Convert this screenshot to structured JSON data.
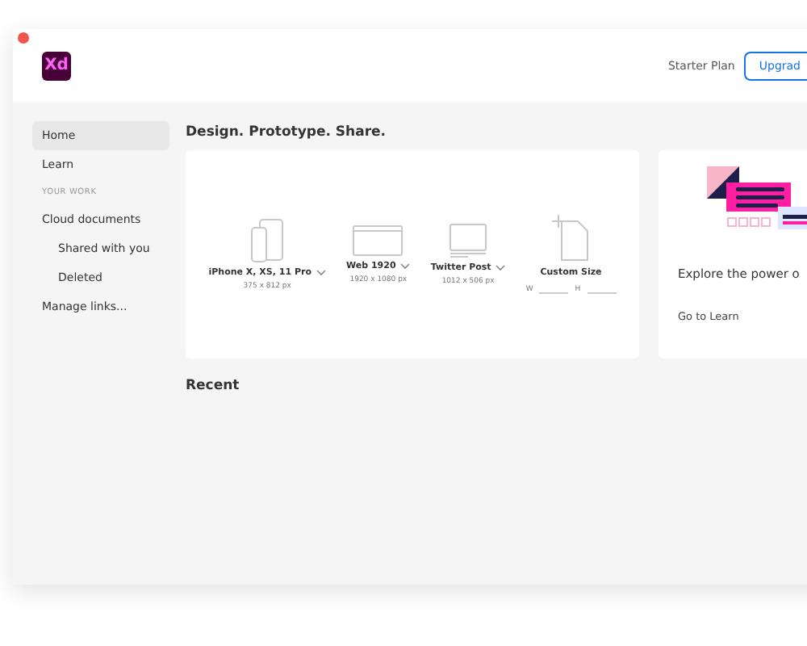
{
  "header": {
    "app_logo": "Xd",
    "plan": "Starter Plan",
    "upgrade_button": "Upgrad"
  },
  "sidebar": {
    "items": [
      {
        "kind": "item",
        "label": "Home",
        "selected": true
      },
      {
        "kind": "item",
        "label": "Learn",
        "selected": false
      },
      {
        "kind": "section",
        "label": "YOUR WORK"
      },
      {
        "kind": "item",
        "label": "Cloud documents",
        "selected": false,
        "children": [
          {
            "label": "Shared with you",
            "selected": false
          },
          {
            "label": "Deleted",
            "selected": false
          }
        ]
      },
      {
        "kind": "item",
        "label": "Manage links...",
        "selected": false
      }
    ]
  },
  "main": {
    "heading": "Design. Prototype. Share.",
    "presets": [
      {
        "kind": "phone",
        "name": "iPhone X, XS, 11 Pro",
        "size": "375 x 812 px"
      },
      {
        "kind": "web",
        "name": "Web 1920",
        "size": "1920 x 1080 px"
      },
      {
        "kind": "monitor",
        "name": "Twitter Post",
        "size": "1012 x 506 px"
      },
      {
        "kind": "custom",
        "name": "Custom Size",
        "width_label": "W",
        "height_label": "H"
      }
    ],
    "learn_card": {
      "title": "Explore the power o",
      "link": "Go to Learn"
    },
    "recent_heading": "Recent"
  }
}
